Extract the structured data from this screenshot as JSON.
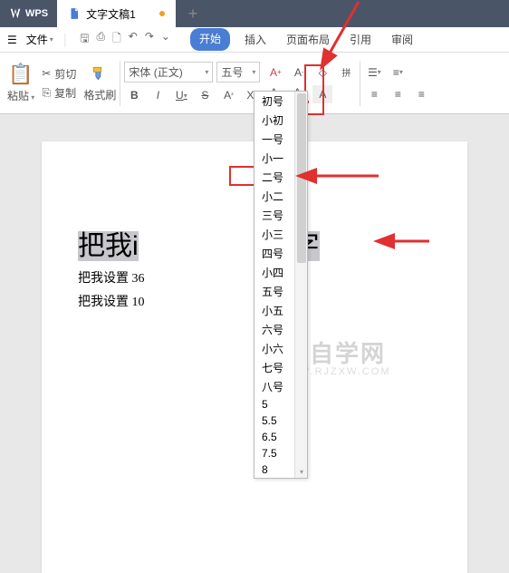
{
  "titlebar": {
    "app_name": "WPS",
    "doc_tab": "文字文稿1",
    "new_tab": "+"
  },
  "menubar": {
    "file": "文件",
    "tabs": {
      "insert": "插入",
      "page_layout": "页面布局",
      "reference": "引用",
      "review": "审阅"
    },
    "start": "开始"
  },
  "ribbon": {
    "paste": "粘贴",
    "cut": "剪切",
    "copy": "复制",
    "format_brush": "格式刷",
    "font_name": "宋体 (正文)",
    "font_size": "五号",
    "bold": "B",
    "italic": "I",
    "underline": "U",
    "strike": "S",
    "ainc": "A",
    "adec": "A"
  },
  "dropdown": {
    "items": [
      "初号",
      "小初",
      "一号",
      "小一",
      "二号",
      "小二",
      "三号",
      "小三",
      "四号",
      "小四",
      "五号",
      "小五",
      "六号",
      "小六",
      "七号",
      "八号",
      "5",
      "5.5",
      "6.5",
      "7.5",
      "8"
    ]
  },
  "document": {
    "line1_before": "把我i",
    "line1_after": "号字",
    "line2": "把我设置 36",
    "line3": "把我设置 10"
  },
  "watermark": {
    "main": "软件自学网",
    "sub": "WWW.RJZXW.COM"
  }
}
